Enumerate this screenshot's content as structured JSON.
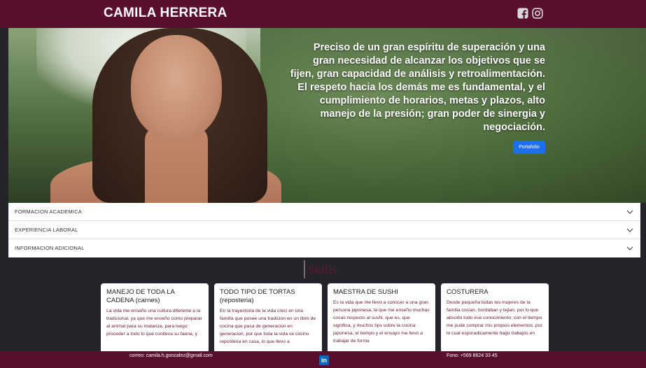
{
  "header": {
    "brand": "CAMILA HERRERA",
    "social_icons": [
      "facebook-icon",
      "instagram-icon"
    ]
  },
  "hero": {
    "text": "Preciso de un gran espíritu de superación y una gran necesidad de alcanzar los objetivos que se fijen, gran capacidad de análisis y retroalimentación. El respeto hacia los demás me es fundamental, y el cumplimiento de horarios, metas y plazos, alto manejo de la presión; gran poder de sinergia y negociación.",
    "button_label": "Portafolio"
  },
  "accordion": {
    "items": [
      {
        "label": "FORMACION ACADEMICA"
      },
      {
        "label": "EXPERIENCIA LABORAL"
      },
      {
        "label": "INFORMACION ADICIONAL"
      }
    ]
  },
  "skills": {
    "title": "Skills",
    "cards": [
      {
        "title": "MANEJO DE TODA LA CADENA (carnes)",
        "text": "La vida me enseño una cultura diferente a la tradicional, ya que me enseño como preparar al animal para su matanza, para luego proceder a todo lo que conlleva su faena, y"
      },
      {
        "title": "TODO TIPO DE TORTAS (reposteria)",
        "text": "En la trayectoria de la vida creci en una familia que posee una tradicion en un libro de cocina que pasa de generacion en generacion, por que toda la vida se cocino reposteria en casa, lo que llevo a"
      },
      {
        "title": "MAESTRA DE SUSHI",
        "text": "Es la vida que me llevo a conocer a una gran persona japonesa, la que me enseño muchas cosas respecto al sushi, que es, que significa, y muchos tips sobre la cocina japonesa, el tiempo y el ensayo me llevo a trabajar de forma"
      },
      {
        "title": "COSTURERA",
        "text": "Desde pequeña todas las mujeres de la familia cocian, bordaban y tejian, por lo que absorbi todo ese conocimiento; con el tiempo me pude comprar mis propios elementos, por lo cual esporadicamente hago trabajos en"
      }
    ]
  },
  "footer": {
    "email": "correo: camila.h.gonzalez@gmail.com",
    "linkedin_label": "in",
    "phone": "Fono: +569 8624 33 45"
  },
  "colors": {
    "brand": "#5b0f2f",
    "background": "#23252b",
    "button": "#1d6ff0",
    "card_text": "#6a1435"
  }
}
